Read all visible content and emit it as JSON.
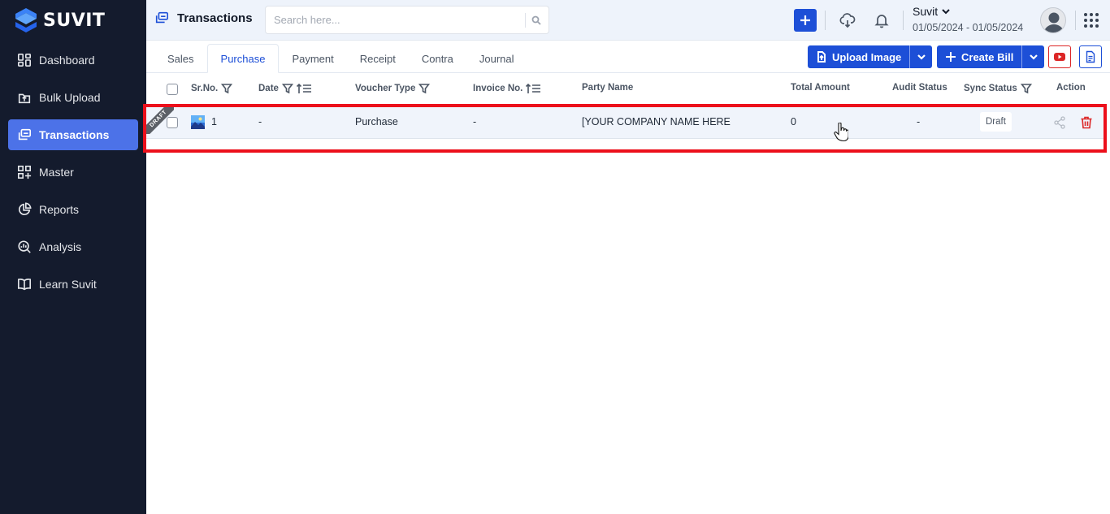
{
  "brand": {
    "name": "SUVIT"
  },
  "sidebar": {
    "items": [
      {
        "label": "Dashboard",
        "icon": "dashboard-icon"
      },
      {
        "label": "Bulk Upload",
        "icon": "upload-icon"
      },
      {
        "label": "Transactions",
        "icon": "transactions-icon",
        "active": true
      },
      {
        "label": "Master",
        "icon": "master-icon"
      },
      {
        "label": "Reports",
        "icon": "pie-chart-icon"
      },
      {
        "label": "Analysis",
        "icon": "analysis-icon"
      },
      {
        "label": "Learn Suvit",
        "icon": "book-icon"
      }
    ]
  },
  "header": {
    "title": "Transactions",
    "search_placeholder": "Search here...",
    "org_name": "Suvit",
    "date_range": "01/05/2024 - 01/05/2024"
  },
  "tabs": [
    "Sales",
    "Purchase",
    "Payment",
    "Receipt",
    "Contra",
    "Journal"
  ],
  "active_tab": "Purchase",
  "actions": {
    "upload_image": "Upload Image",
    "create_bill": "Create Bill"
  },
  "table": {
    "columns": [
      "Sr.No.",
      "Date",
      "Voucher Type",
      "Invoice No.",
      "Party Name",
      "Total Amount",
      "Audit Status",
      "Sync Status",
      "Action"
    ],
    "rows": [
      {
        "ribbon": "DRAFT",
        "sr_no": "1",
        "date": "-",
        "voucher_type": "Purchase",
        "invoice_no": "-",
        "party_name": "[YOUR COMPANY NAME HERE",
        "total_amount": "0",
        "audit_status": "-",
        "sync_status": "Draft"
      }
    ]
  },
  "colors": {
    "sidebar_bg": "#141b2d",
    "accent": "#1d4fd7",
    "active_nav": "#4c72e8",
    "highlight": "#ec0f1b",
    "delete": "#dc2626"
  }
}
